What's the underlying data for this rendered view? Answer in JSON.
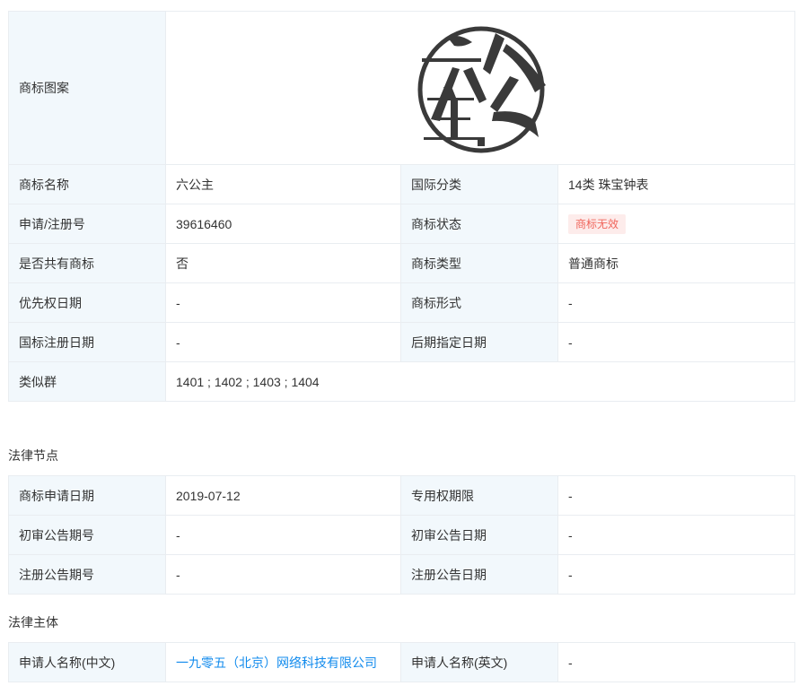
{
  "trademark": {
    "image_label": "商标图案",
    "rows": {
      "name_label": "商标名称",
      "name_value": "六公主",
      "intl_class_label": "国际分类",
      "intl_class_value": "14类 珠宝钟表",
      "reg_no_label": "申请/注册号",
      "reg_no_value": "39616460",
      "status_label": "商标状态",
      "status_value": "商标无效",
      "shared_label": "是否共有商标",
      "shared_value": "否",
      "type_label": "商标类型",
      "type_value": "普通商标",
      "priority_date_label": "优先权日期",
      "priority_date_value": "-",
      "form_label": "商标形式",
      "form_value": "-",
      "intl_reg_date_label": "国标注册日期",
      "intl_reg_date_value": "-",
      "later_date_label": "后期指定日期",
      "later_date_value": "-",
      "similar_group_label": "类似群",
      "similar_group_value": "1401 ; 1402 ; 1403 ; 1404"
    }
  },
  "legal_nodes": {
    "title": "法律节点",
    "apply_date_label": "商标申请日期",
    "apply_date_value": "2019-07-12",
    "exclusive_period_label": "专用权期限",
    "exclusive_period_value": "-",
    "prelim_issue_label": "初审公告期号",
    "prelim_issue_value": "-",
    "prelim_date_label": "初审公告日期",
    "prelim_date_value": "-",
    "reg_issue_label": "注册公告期号",
    "reg_issue_value": "-",
    "reg_date_label": "注册公告日期",
    "reg_date_value": "-"
  },
  "legal_subject": {
    "title": "法律主体",
    "applicant_cn_label": "申请人名称(中文)",
    "applicant_cn_value": "一九零五（北京）网络科技有限公司",
    "applicant_en_label": "申请人名称(英文)",
    "applicant_en_value": "-"
  },
  "colors": {
    "label_bg": "#f2f8fc",
    "border": "#e9edf1",
    "link": "#128bed",
    "badge_text": "#f0655b",
    "badge_bg": "#fdeceb",
    "logo": "#3a3a3a"
  }
}
